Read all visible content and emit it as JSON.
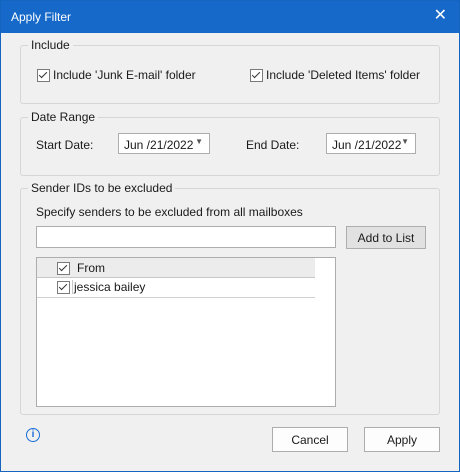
{
  "title": "Apply Filter",
  "close_icon": "close-icon",
  "include": {
    "legend": "Include",
    "junk_label": "Include 'Junk E-mail' folder",
    "deleted_label": "Include 'Deleted Items' folder"
  },
  "date_range": {
    "legend": "Date Range",
    "start_label": "Start Date:",
    "start_value": "Jun /21/2022",
    "end_label": "End Date:",
    "end_value": "Jun /21/2022"
  },
  "sender": {
    "legend": "Sender IDs to be excluded",
    "desc": "Specify senders to be excluded from all mailboxes",
    "input_value": "",
    "add_button": "Add to List",
    "column_header": "From",
    "rows": [
      "jessica bailey"
    ]
  },
  "footer": {
    "cancel": "Cancel",
    "apply": "Apply",
    "info_icon": "info-icon"
  }
}
